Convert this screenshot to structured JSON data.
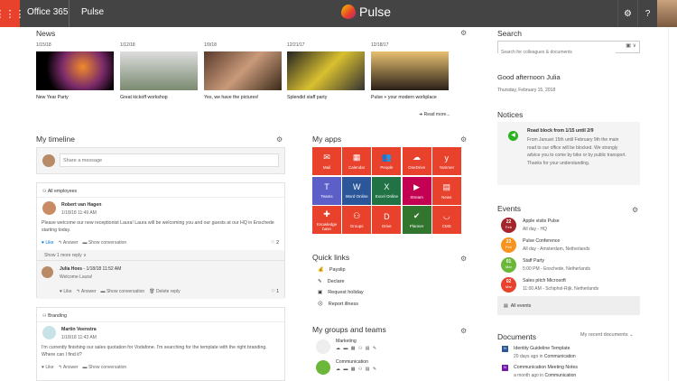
{
  "topbar": {
    "suite": "Office 365",
    "app": "Pulse",
    "brand": "Pulse"
  },
  "news": {
    "title": "News",
    "read_more": "Read more...",
    "items": [
      {
        "date": "1/15/18",
        "caption": "New Year Party"
      },
      {
        "date": "1/12/18",
        "caption": "Great kickoff workshop"
      },
      {
        "date": "1/9/18",
        "caption": "Yes, we have the pictures!"
      },
      {
        "date": "12/21/17",
        "caption": "Splendid staff party"
      },
      {
        "date": "12/18/17",
        "caption": "Pulse + your modern workplace"
      }
    ]
  },
  "timeline": {
    "title": "My timeline",
    "share_placeholder": "Share a message",
    "posts": [
      {
        "group": "All employees",
        "author": "Robert van Hagen",
        "time": "1/18/18 11:49 AM",
        "text": "Please welcome our new receptionist Laura! Laura will be welcoming you and our guests at our HQ in Enschede starting today.",
        "like": "Like",
        "answer": "Answer",
        "show": "Show conversation",
        "likes": "2",
        "more": "Show 1 more reply",
        "reply": {
          "author": "Julia Hoes",
          "time": " - 1/18/18 11:52 AM",
          "text": "Welcome Laura!",
          "like": "Like",
          "answer": "Answer",
          "show": "Show conversation",
          "delete": "Delete reply",
          "likes": "1"
        }
      },
      {
        "group": "Branding",
        "author": "Martin Veenstra",
        "time": "1/18/18 11:43 AM",
        "text": "I'm currently finishing our sales quotation for Vodafone. I'm searching for the template with the right branding. Where can I find it?",
        "like": "Like",
        "answer": "Answer",
        "show": "Show conversation"
      }
    ]
  },
  "apps": {
    "title": "My apps",
    "tiles": [
      {
        "label": "Mail",
        "color": "#e8412c",
        "icon": "✉"
      },
      {
        "label": "Calendar",
        "color": "#e8412c",
        "icon": "▦"
      },
      {
        "label": "People",
        "color": "#e8412c",
        "icon": "👥"
      },
      {
        "label": "OneDrive",
        "color": "#e8412c",
        "icon": "☁"
      },
      {
        "label": "Yammer",
        "color": "#e8412c",
        "icon": "y"
      },
      {
        "label": "Teams",
        "color": "#5b5fc7",
        "icon": "T"
      },
      {
        "label": "Word Online",
        "color": "#2b579a",
        "icon": "W"
      },
      {
        "label": "Excel Online",
        "color": "#217346",
        "icon": "X"
      },
      {
        "label": "Stream",
        "color": "#c30052",
        "icon": "▶"
      },
      {
        "label": "News",
        "color": "#e8412c",
        "icon": "▤"
      },
      {
        "label": "Knowledge base",
        "color": "#e8412c",
        "icon": "✚"
      },
      {
        "label": "Groups",
        "color": "#e8412c",
        "icon": "⚇"
      },
      {
        "label": "Drive",
        "color": "#e8412c",
        "icon": "D"
      },
      {
        "label": "Planner",
        "color": "#31752f",
        "icon": "✔"
      },
      {
        "label": "CMS",
        "color": "#e8412c",
        "icon": "◡"
      }
    ]
  },
  "quick_links": {
    "title": "Quick links",
    "items": [
      "Payslip",
      "Declare",
      "Request holiday",
      "Report illness"
    ]
  },
  "groups": {
    "title": "My groups and teams",
    "items": [
      "Marketing",
      "Communication"
    ]
  },
  "search": {
    "title": "Search",
    "placeholder": "Search for colleagues & documents"
  },
  "greeting": {
    "text": "Good afternoon Julia",
    "date": "Thursday, February 15, 2018"
  },
  "notices": {
    "title": "Notices",
    "heading": "Road block from 1/15 until 2/9",
    "body": "From Januari 15th until February 9th the main road to our office will be blocked. We strongly advice you to come by bike or by public transport. Thanks for your understanding."
  },
  "events": {
    "title": "Events",
    "all": "All events",
    "items": [
      {
        "day": "22",
        "month": "Feb",
        "title": "Apple visits Pulse",
        "detail": "All day - HQ",
        "color": "#a4262c"
      },
      {
        "day": "23",
        "month": "Feb",
        "title": "Pulse Conference",
        "detail": "All day - Amsterdam, Netherlands",
        "color": "#f7931e"
      },
      {
        "day": "01",
        "month": "Mar",
        "title": "Staff Party",
        "detail": "5:00 PM - Enschede, Netherlands",
        "color": "#6bb739"
      },
      {
        "day": "02",
        "month": "Mar",
        "title": "Sales pitch Microsoft",
        "detail": "11:00 AM - Schiphol-Rijk, Netherlands",
        "color": "#e8412c"
      }
    ]
  },
  "documents": {
    "title": "Documents",
    "filter": "My recent documents",
    "items": [
      {
        "name": "Identity Guideline Template",
        "age": "20 days ago in ",
        "loc": "Communication",
        "color": "#2b579a"
      },
      {
        "name": "Communication Meeting Notes",
        "age": "a month ago in ",
        "loc": "Communication",
        "color": "#7719aa"
      }
    ]
  }
}
